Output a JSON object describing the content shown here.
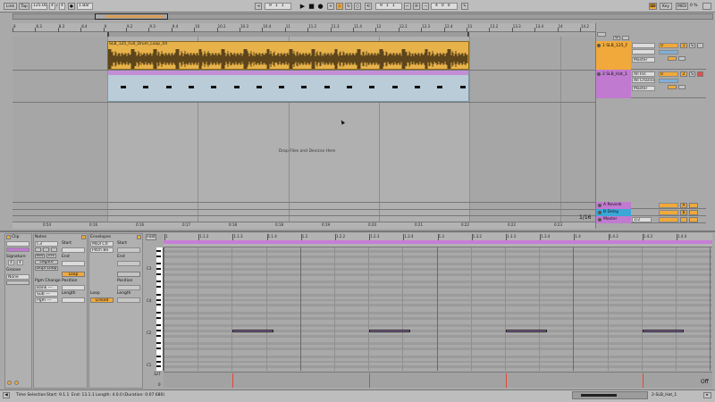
{
  "transport": {
    "link": "Link",
    "tap": "Tap",
    "tempo": "125.00",
    "sig_num": "4",
    "sig_den": "4",
    "quantize": "1 Bar",
    "arr_pos": [
      "9",
      "1",
      "1"
    ],
    "loop_start": [
      "9",
      "1",
      "1"
    ],
    "loop_len": [
      "4",
      "0",
      "0"
    ],
    "key": "Key",
    "midi": "MIDI",
    "cpu": "0 %",
    "d_label": "D"
  },
  "ruler": [
    "8",
    "8.3",
    "8.3",
    "8.4",
    "9",
    "9.2",
    "9.3",
    "9.4",
    "10",
    "10.2",
    "10.3",
    "10.4",
    "11",
    "11.2",
    "11.3",
    "11.4",
    "12",
    "12.2",
    "12.3",
    "12.4",
    "13",
    "13.2",
    "13.3",
    "13.4",
    "14",
    "14.2"
  ],
  "time_ruler": [
    "0:54",
    "0:16",
    "0:16",
    "0:17",
    "0:18",
    "0:18",
    "0:19",
    "0:20",
    "0:21",
    "0:22",
    "0:22",
    "0:23",
    "0:24",
    "0:25"
  ],
  "clips": {
    "audio_name": "SLB_125_Full_Drum_Loop_04",
    "midi_name": ""
  },
  "drop_zone": "Drop Files and Devices Here",
  "zoom_label": "1/16",
  "tracks": [
    {
      "name": "1 SLB_125_F",
      "input": "",
      "in_type": "",
      "output": "Master",
      "vol": "0",
      "color": "#f0a93a",
      "num": "1",
      "s": "S"
    },
    {
      "name": "2 SLB_Hat_1",
      "input": "All Ins",
      "in_type": "All Channe",
      "output": "Master",
      "vol": "0",
      "color": "#c07ad0",
      "num": "2",
      "s": "S"
    }
  ],
  "returns": [
    {
      "name": "A Reverb",
      "letter": "A",
      "color": "#c07ad0"
    },
    {
      "name": "B Delay",
      "letter": "B",
      "color": "#3ba7d6"
    },
    {
      "name": "Master",
      "letter": "",
      "color": "#c07ad0"
    }
  ],
  "master_ratio": "1/2",
  "clip_panel": {
    "clip_title": "Clip",
    "signature": "Signature",
    "sig_num": "4",
    "sig_den": "4",
    "groove": "Groove",
    "groove_val": "None",
    "notes_title": "Notes",
    "start": "Start",
    "end": "End",
    "rev": "Rev",
    "inv": "Inv",
    "legato": "Legato",
    "dupl_loop": "Dupl.Loop",
    "loop": "Loop",
    "pgm_change": "Pgm Change",
    "bank": "Bank ---",
    "sub": "Sub ---",
    "pgm": "Pgm ---",
    "position": "Position",
    "length": "Length",
    "note_field": "C3",
    "envelopes_title": "Envelopes",
    "env_src": "MIDI Ctr",
    "env_ctrl": "Pitch Be",
    "env_start": "Start",
    "env_end": "End",
    "env_loop": "Loop",
    "env_linked": "Linked",
    "env_position": "Position",
    "env_length": "Length"
  },
  "editor": {
    "fold": "Fold",
    "ruler": [
      "1",
      "1.1.2",
      "1.1.3",
      "1.1.4",
      "1.2",
      "1.2.2",
      "1.2.3",
      "1.2.4",
      "1.3",
      "1.3.2",
      "1.3.3",
      "1.3.4",
      "1.4",
      "1.4.2",
      "1.4.3",
      "1.4.4"
    ],
    "octaves": [
      "C3",
      "C4",
      "C2",
      "C1"
    ],
    "velocity_max": "127",
    "velocity_min": "0",
    "off": "Off"
  },
  "status": {
    "label": "Time Selection",
    "start": "Start: 9.1.1",
    "end": "End: 13.1.1",
    "length": "Length: 4.0.0",
    "duration": "(Duration: 0:07.680)",
    "track": "2-SLB_Hat_1"
  }
}
